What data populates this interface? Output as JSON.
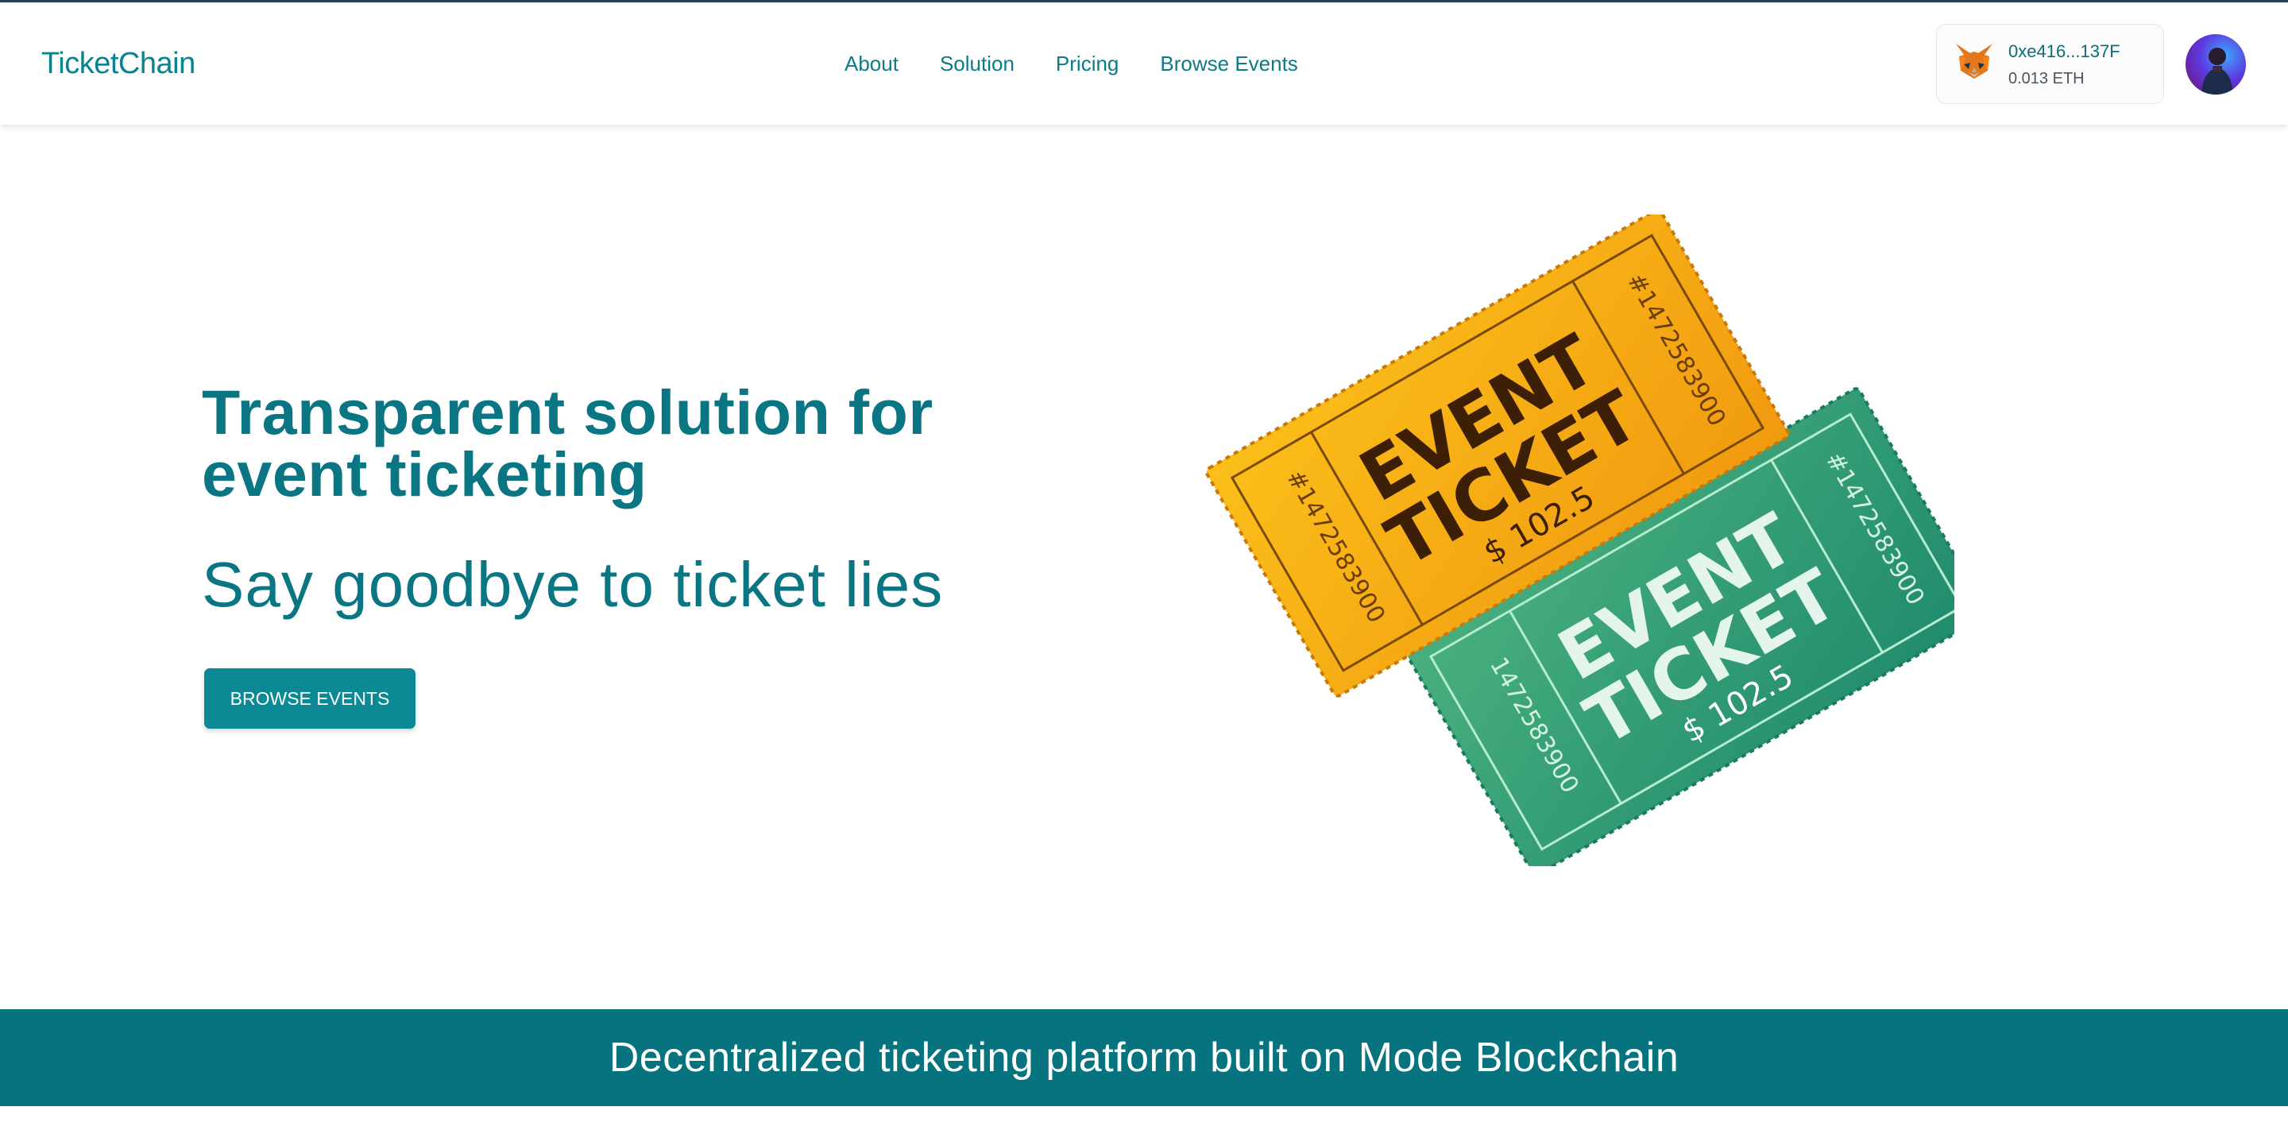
{
  "header": {
    "logo": "TicketChain",
    "nav": [
      "About",
      "Solution",
      "Pricing",
      "Browse Events"
    ],
    "wallet": {
      "address": "0xe416...137F",
      "balance": "0.013 ETH",
      "icon": "metamask-fox-icon"
    },
    "avatar": "user-avatar"
  },
  "hero": {
    "title": "Transparent solution for event ticketing",
    "subtitle": "Say goodbye to ticket lies",
    "cta": "BROWSE EVENTS",
    "illustration": {
      "front_ticket": {
        "line1": "EVENT",
        "line2": "TICKET",
        "price": "$ 102.5",
        "serial": "#1472583900",
        "stub_serial": "#1472583900",
        "color": "#f3a712"
      },
      "back_ticket": {
        "line1": "EVENT",
        "line2": "TICKET",
        "price": "$ 102.5",
        "serial": "#1472583900",
        "stub_serial": "1472583900",
        "color": "#3a9e78"
      }
    }
  },
  "banner": {
    "text": "Decentralized ticketing platform built on Mode Blockchain"
  },
  "colors": {
    "brand": "#07848f",
    "banner": "#07737e",
    "button": "#0b8a96"
  }
}
